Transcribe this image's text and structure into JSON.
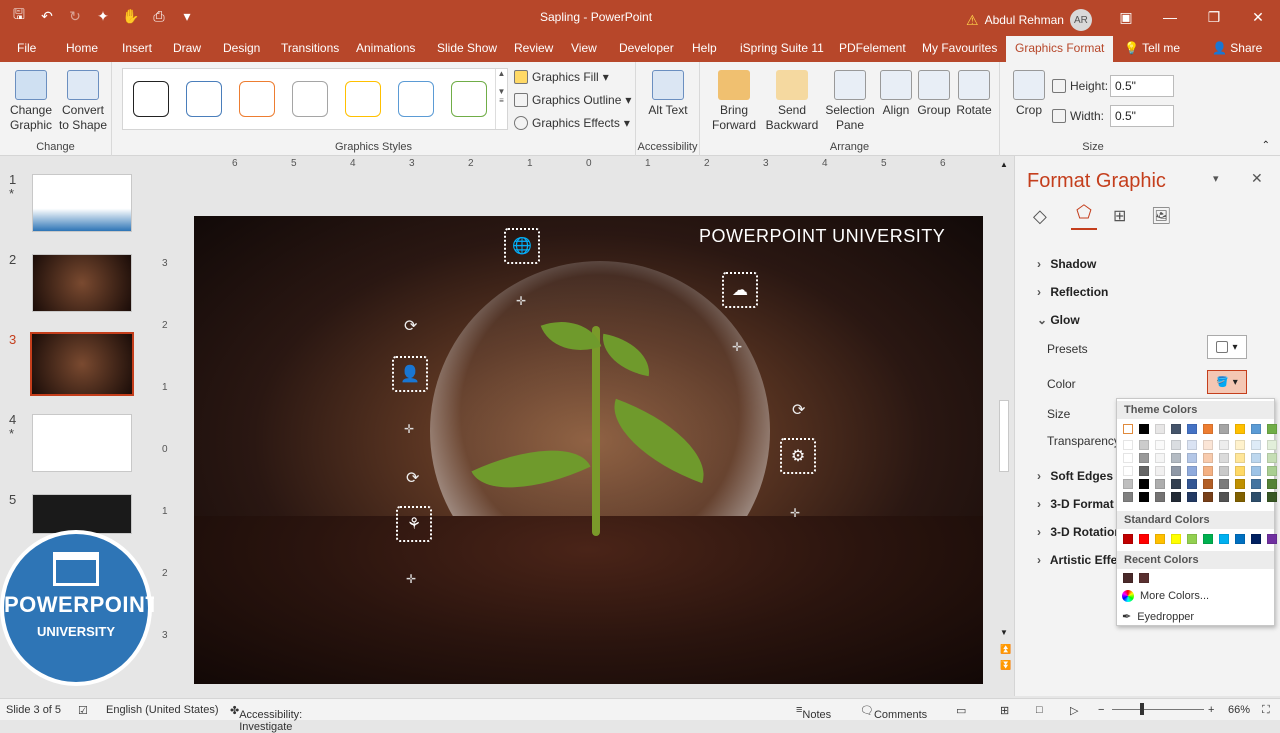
{
  "window": {
    "title": "Sapling  -  PowerPoint",
    "user": "Abdul Rehman",
    "user_initials": "AR",
    "warning_icon": "warning-icon"
  },
  "tabs": [
    "File",
    "Home",
    "Insert",
    "Draw",
    "Design",
    "Transitions",
    "Animations",
    "Slide Show",
    "Review",
    "View",
    "Developer",
    "Help",
    "iSpring Suite 11",
    "PDFelement",
    "My Favourites",
    "Graphics Format",
    "Tell me",
    "Share"
  ],
  "ribbon": {
    "change": {
      "change_graphic": "Change Graphic",
      "convert": "Convert to Shape",
      "label": "Change"
    },
    "styles": {
      "fill": "Graphics Fill",
      "outline": "Graphics Outline",
      "effects": "Graphics Effects",
      "label": "Graphics Styles",
      "swatch_colors": [
        "#222222",
        "#4a7ebb",
        "#ed7d31",
        "#a5a5a5",
        "#ffc000",
        "#5b9bd5",
        "#70ad47"
      ]
    },
    "accessibility": {
      "alt_text": "Alt Text",
      "label": "Accessibility"
    },
    "arrange": {
      "bring": "Bring Forward",
      "send": "Send Backward",
      "selection": "Selection Pane",
      "align": "Align",
      "group": "Group",
      "rotate": "Rotate",
      "label": "Arrange"
    },
    "size": {
      "crop": "Crop",
      "height_label": "Height:",
      "height_value": "0.5\"",
      "width_label": "Width:",
      "width_value": "0.5\"",
      "label": "Size"
    }
  },
  "slides": [
    {
      "num": "1",
      "star": "*"
    },
    {
      "num": "2",
      "star": ""
    },
    {
      "num": "3",
      "star": ""
    },
    {
      "num": "4",
      "star": "*"
    },
    {
      "num": "5",
      "star": ""
    }
  ],
  "logo": {
    "line1": "POWERPOINT",
    "line2": "UNIVERSITY"
  },
  "slide": {
    "title": "POWERPOINT UNIVERSITY"
  },
  "ruler": {
    "h": [
      "6",
      "5",
      "4",
      "3",
      "2",
      "1",
      "0",
      "1",
      "2",
      "3",
      "4",
      "5",
      "6"
    ],
    "v": [
      "3",
      "2",
      "1",
      "0",
      "1",
      "2",
      "3"
    ]
  },
  "pane": {
    "title": "Format Graphic",
    "sections": {
      "shadow": "Shadow",
      "reflection": "Reflection",
      "glow": "Glow",
      "soft_edges": "Soft Edges",
      "format3d": "3-D Format",
      "rotation3d": "3-D Rotation",
      "artistic": "Artistic Effects"
    },
    "glow_props": {
      "presets": "Presets",
      "color": "Color",
      "size": "Size",
      "transparency": "Transparency"
    }
  },
  "color_menu": {
    "theme": "Theme Colors",
    "standard": "Standard Colors",
    "recent": "Recent Colors",
    "more": "More Colors...",
    "eyedropper": "Eyedropper",
    "theme_top": [
      "#ffffff",
      "#000000",
      "#e7e6e6",
      "#44546a",
      "#4472c4",
      "#ed7d31",
      "#a5a5a5",
      "#ffc000",
      "#5b9bd5",
      "#70ad47"
    ],
    "standard_colors": [
      "#c00000",
      "#ff0000",
      "#ffc000",
      "#ffff00",
      "#92d050",
      "#00b050",
      "#00b0f0",
      "#0070c0",
      "#002060",
      "#7030a0"
    ],
    "recent_colors": [
      "#4a2a2a",
      "#5a3030"
    ]
  },
  "status": {
    "slide": "Slide 3 of 5",
    "language": "English (United States)",
    "accessibility": "Accessibility: Investigate",
    "notes": "Notes",
    "comments": "Comments",
    "zoom": "66%"
  }
}
